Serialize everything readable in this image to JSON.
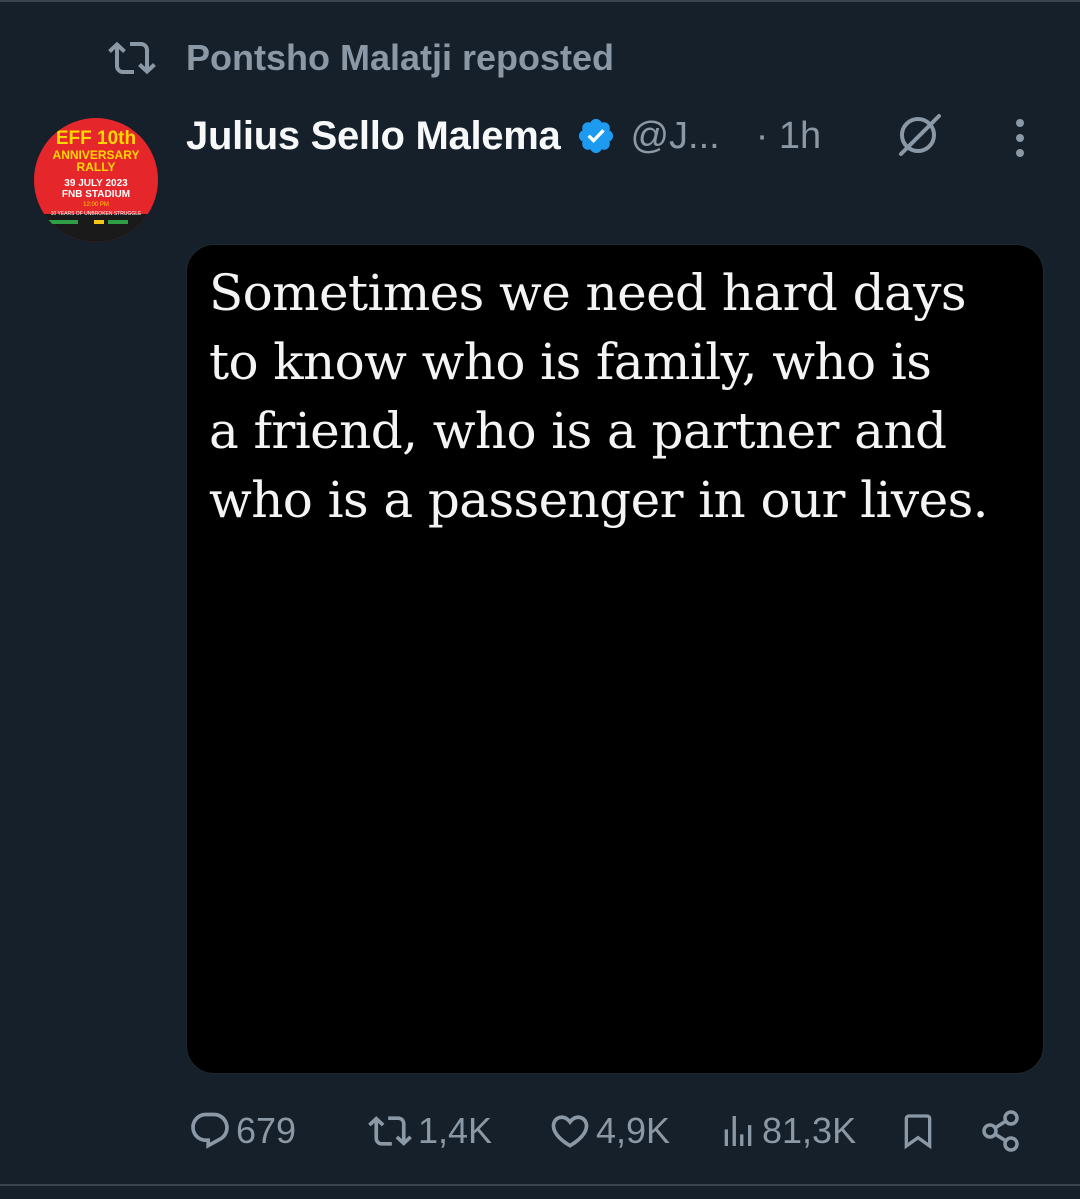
{
  "repost": {
    "text": "Pontsho Malatji reposted",
    "icon": "repost-icon"
  },
  "author": {
    "name": "Julius Sello Malema",
    "handle": "@J...",
    "time": "· 1h",
    "verified_color": "#1d9bf0"
  },
  "avatar": {
    "line1": "EFF 10th",
    "line2": "ANNIVERSARY",
    "line3": "RALLY",
    "line4": "39 JULY 2023",
    "line5": "FNB STADIUM",
    "line6": "12:00 PM",
    "line7": "10 YEARS OF UNBROKEN STRUGGLE"
  },
  "post": {
    "image_text": "Sometimes we need hard days\nto know who is family, who is\na friend, who is a partner and\nwho is a passenger in our lives."
  },
  "actions": {
    "replies": "679",
    "reposts": "1,4K",
    "likes": "4,9K",
    "views": "81,3K"
  },
  "colors": {
    "background": "#15202b",
    "secondary_text": "#8b98a5",
    "primary_text": "#f7f9f9"
  }
}
